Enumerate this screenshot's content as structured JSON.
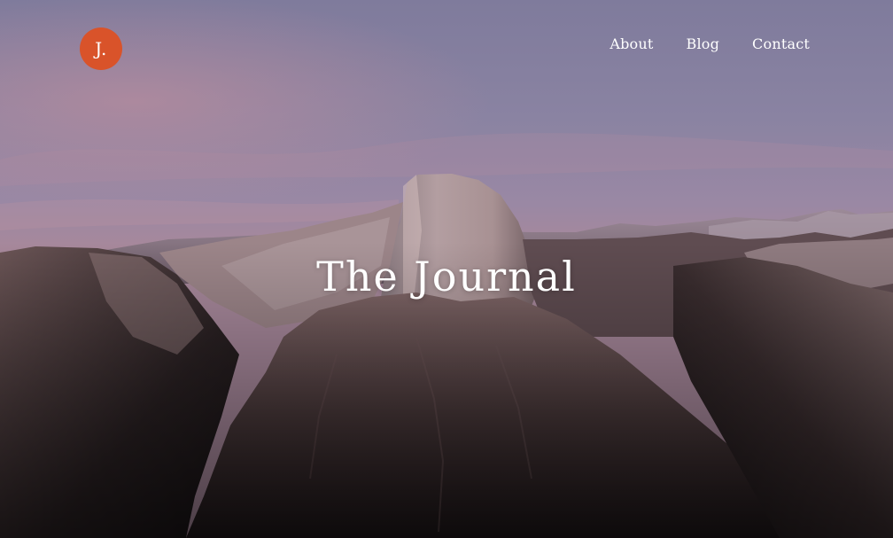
{
  "site": {
    "logo_text": "J.",
    "accent_color": "#d9532a"
  },
  "nav": {
    "items": [
      {
        "label": "About"
      },
      {
        "label": "Blog"
      },
      {
        "label": "Contact"
      }
    ]
  },
  "hero": {
    "title": "The Journal",
    "background": "mountain-dusk-photo"
  }
}
